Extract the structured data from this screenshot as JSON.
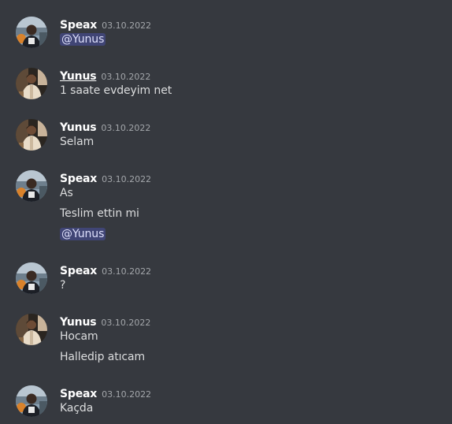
{
  "colors": {
    "background": "#36393f",
    "username": "#ffffff",
    "timestamp": "#a3a6aa",
    "message_text": "#dcddde",
    "mention_bg": "#3e4483",
    "mention_text": "#dee0fc"
  },
  "messages": [
    {
      "author": "Speax",
      "avatar_icon": "speax-avatar-icon",
      "timestamp": "03.10.2022",
      "lines": [
        {
          "text": "@Yunus",
          "mention": true
        }
      ]
    },
    {
      "author": "Yunus",
      "avatar_icon": "yunus-avatar-icon",
      "timestamp": "03.10.2022",
      "lines": [
        {
          "text": "1 saate evdeyim net",
          "mention": false
        }
      ]
    },
    {
      "author": "Yunus",
      "avatar_icon": "yunus-avatar-icon",
      "timestamp": "03.10.2022",
      "lines": [
        {
          "text": "Selam",
          "mention": false
        }
      ]
    },
    {
      "author": "Speax",
      "avatar_icon": "speax-avatar-icon",
      "timestamp": "03.10.2022",
      "lines": [
        {
          "text": "As",
          "mention": false
        },
        {
          "text": "Teslim ettin mi",
          "mention": false
        },
        {
          "text": "@Yunus",
          "mention": true
        }
      ]
    },
    {
      "author": "Speax",
      "avatar_icon": "speax-avatar-icon",
      "timestamp": "03.10.2022",
      "lines": [
        {
          "text": "?",
          "mention": false
        }
      ]
    },
    {
      "author": "Yunus",
      "avatar_icon": "yunus-avatar-icon",
      "timestamp": "03.10.2022",
      "lines": [
        {
          "text": "Hocam",
          "mention": false
        },
        {
          "text": "Halledip atıcam",
          "mention": false
        }
      ]
    },
    {
      "author": "Speax",
      "avatar_icon": "speax-avatar-icon",
      "timestamp": "03.10.2022",
      "lines": [
        {
          "text": "Kaçda",
          "mention": false
        }
      ]
    }
  ]
}
